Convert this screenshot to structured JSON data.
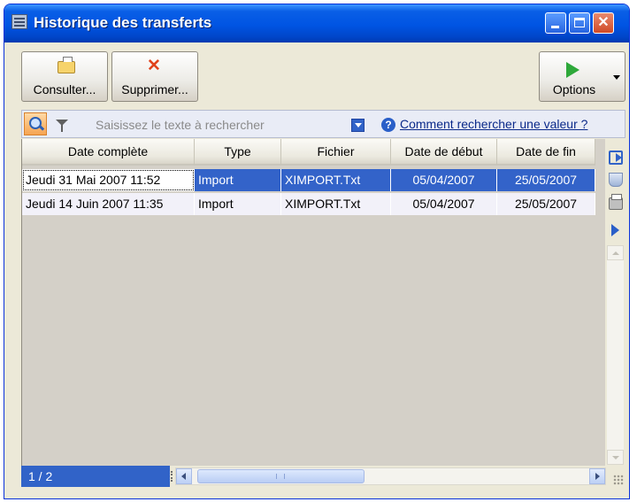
{
  "window": {
    "title": "Historique des transferts",
    "controls": [
      "minimize",
      "maximize",
      "close"
    ],
    "close_symbol": "✕"
  },
  "toolbar": {
    "consult_label": "Consulter...",
    "delete_label": "Supprimer...",
    "options_label": "Options",
    "delete_symbol": "✕"
  },
  "search": {
    "placeholder": "Saisissez le texte à rechercher",
    "help_symbol": "?",
    "help_link": "Comment rechercher une valeur ?"
  },
  "table": {
    "columns": [
      "Date complète",
      "Type",
      "Fichier",
      "Date de début",
      "Date de fin"
    ],
    "rows": [
      [
        "Jeudi 31 Mai 2007 11:52",
        "Import",
        "XIMPORT.Txt",
        "05/04/2007",
        "25/05/2007"
      ],
      [
        "Jeudi 14 Juin 2007 11:35",
        "Import",
        "XIMPORT.Txt",
        "05/04/2007",
        "25/05/2007"
      ]
    ],
    "selected_row": 0
  },
  "status": {
    "page_counter": "1 / 2"
  },
  "icons": {
    "consult": "folder-icon",
    "delete": "delete-icon",
    "options": "play-icon",
    "search": "search-icon",
    "filter": "filter-icon",
    "help": "help-icon",
    "side": [
      "export-icon",
      "cup-icon",
      "print-icon",
      "arrow-right-icon"
    ]
  },
  "colors": {
    "title_bar": "#0054e3",
    "selection": "#3363c9",
    "background": "#ece9d8",
    "grid_background": "#d4d0c8",
    "delete_icon": "#e0421b",
    "play_icon": "#2ea83a"
  }
}
